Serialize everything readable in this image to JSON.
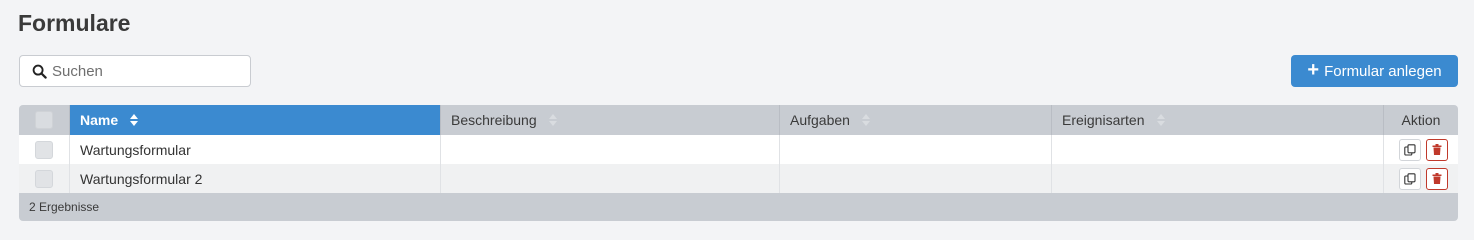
{
  "page": {
    "title": "Formulare"
  },
  "search": {
    "placeholder": "Suchen",
    "value": ""
  },
  "toolbar": {
    "add_label": "Formular anlegen"
  },
  "table": {
    "columns": [
      "Name",
      "Beschreibung",
      "Aufgaben",
      "Ereignisarten",
      "Aktion"
    ],
    "sorted_column": "Name",
    "rows": [
      {
        "name": "Wartungsformular",
        "description": "",
        "tasks": "",
        "event_types": ""
      },
      {
        "name": "Wartungsformular 2",
        "description": "",
        "tasks": "",
        "event_types": ""
      }
    ],
    "result_count": "2 Ergebnisse"
  },
  "colors": {
    "accent": "#3b8ad0",
    "header": "#c8ccd2",
    "delete": "#c0392b"
  },
  "icons": {
    "search": "search-icon",
    "add": "plus-icon",
    "copy": "copy-icon",
    "delete": "trash-icon"
  }
}
